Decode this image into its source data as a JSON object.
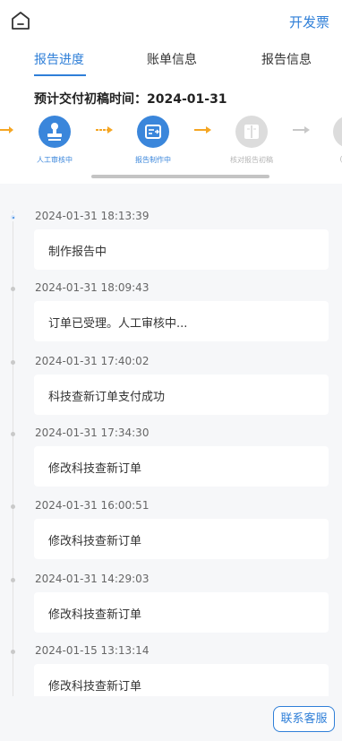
{
  "header": {
    "invoice_label": "开发票"
  },
  "tabs": [
    {
      "label": "报告进度",
      "active": true
    },
    {
      "label": "账单信息",
      "active": false
    },
    {
      "label": "报告信息",
      "active": false
    }
  ],
  "deadline": {
    "text": "预计交付初稿时间：2024-01-31"
  },
  "steps": [
    {
      "label": "人工审核中",
      "status": "done",
      "icon": "stamp-icon"
    },
    {
      "label": "报告制作中",
      "status": "current",
      "icon": "report-icon"
    },
    {
      "label": "核对报告初稿",
      "status": "todo",
      "icon": "book-icon"
    },
    {
      "label": "(",
      "status": "todo",
      "icon": "step-icon"
    }
  ],
  "timeline": [
    {
      "time": "2024-01-31 18:13:39",
      "text": "制作报告中",
      "active": true
    },
    {
      "time": "2024-01-31 18:09:43",
      "text": "订单已受理。人工审核中...",
      "active": false
    },
    {
      "time": "2024-01-31 17:40:02",
      "text": "科技查新订单支付成功",
      "active": false
    },
    {
      "time": "2024-01-31 17:34:30",
      "text": "修改科技查新订单",
      "active": false
    },
    {
      "time": "2024-01-31 16:00:51",
      "text": "修改科技查新订单",
      "active": false
    },
    {
      "time": "2024-01-31 14:29:03",
      "text": "修改科技查新订单",
      "active": false
    },
    {
      "time": "2024-01-15 13:13:14",
      "text": "修改科技查新订单",
      "active": false
    }
  ],
  "footer": {
    "contact_label": "联系客服"
  },
  "colors": {
    "accent": "#2f7fd8",
    "step_done": "#3a86db",
    "step_todo": "#dcdcdc",
    "arrow_done": "#f5a623",
    "arrow_todo": "#c8c8c8"
  }
}
